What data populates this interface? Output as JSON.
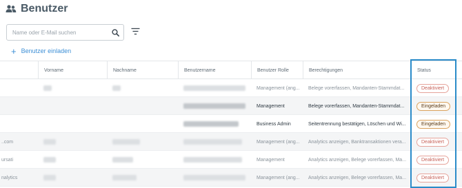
{
  "header": {
    "title": "Benutzer",
    "icon": "users-icon"
  },
  "search": {
    "placeholder": "Name oder E-Mail suchen",
    "value": ""
  },
  "toolbar": {
    "filter_icon": "filter-icon"
  },
  "invite": {
    "label": "Benutzer einladen"
  },
  "table": {
    "columns": [
      "Vorname",
      "Nachname",
      "Benutzername",
      "Benutzer Rolle",
      "Berechtigungen",
      "Status"
    ],
    "rows": [
      {
        "role": "Management (ang...",
        "permissions": "Belege vorerfassen, Mandanten-Stammdat...",
        "status": "Deaktiviert",
        "partial": ""
      },
      {
        "role": "Management",
        "permissions": "Belege vorerfassen, Mandanten-Stammdat...",
        "status": "Eingeladen",
        "partial": ""
      },
      {
        "role": "Business Admin",
        "permissions": "Seitentrennung bestätigen, Löschen und Wi...",
        "status": "Eingeladen",
        "partial": ""
      },
      {
        "role": "Management (ang...",
        "permissions": "Analytics anzeigen, Banktransaktionen vera...",
        "status": "Deaktiviert",
        "partial": "..com"
      },
      {
        "role": "Management",
        "permissions": "Analytics anzeigen, Belege vorerfassen, Ma...",
        "status": "Deaktiviert",
        "partial": "ursati"
      },
      {
        "role": "Management (ang...",
        "permissions": "Analytics anzeigen, Belege vorerfassen, Ma...",
        "status": "Deaktiviert",
        "partial": "nalytics"
      }
    ]
  },
  "colors": {
    "accent": "#3d8fd6",
    "highlight": "#2a8bc9",
    "deaktiviert": "#c7635a",
    "eingeladen": "#d9a25e"
  }
}
